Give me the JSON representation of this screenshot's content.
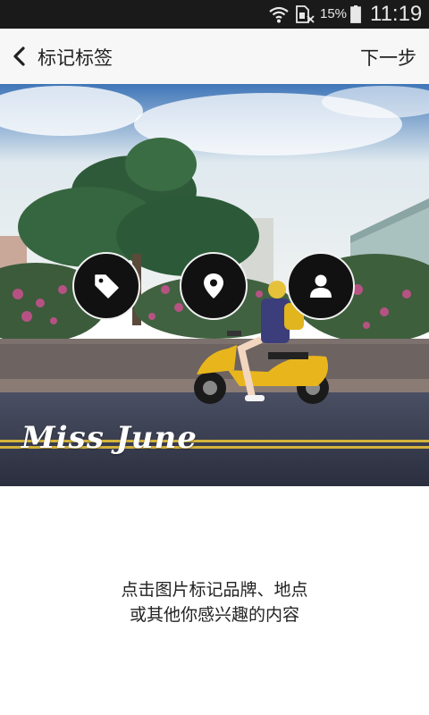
{
  "status_bar": {
    "battery_percent": "15%",
    "time": "11:19",
    "icons": [
      "wifi-icon",
      "sim-no-signal-icon",
      "battery-icon"
    ]
  },
  "header": {
    "back_icon": "chevron-left-icon",
    "title": "标记标签",
    "next_label": "下一步"
  },
  "photo": {
    "watermark": "Miss June",
    "tag_buttons": [
      {
        "icon": "price-tag-icon"
      },
      {
        "icon": "location-pin-icon"
      },
      {
        "icon": "person-icon"
      }
    ]
  },
  "hint": {
    "line1": "点击图片标记品牌、地点",
    "line2": "或其他你感兴趣的内容"
  }
}
